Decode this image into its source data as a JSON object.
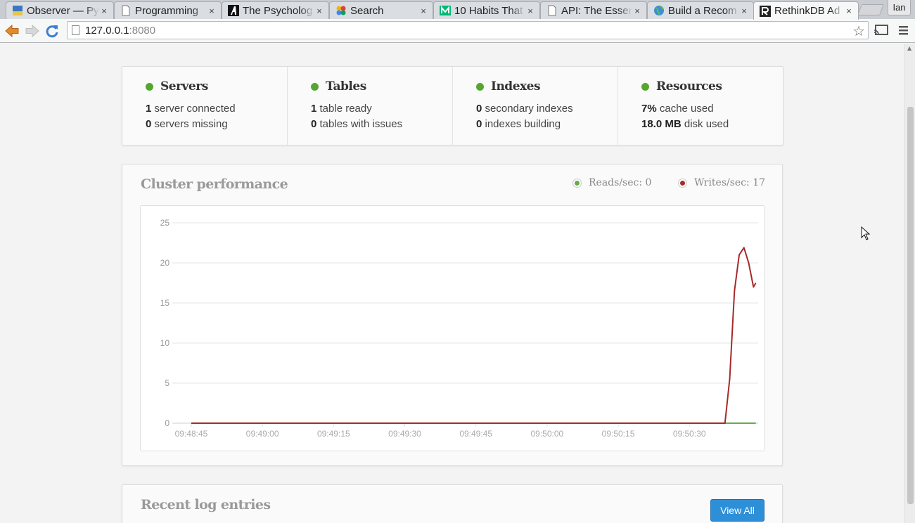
{
  "browser": {
    "tabs": [
      {
        "title": "Observer — Py",
        "icon": "observer-favicon"
      },
      {
        "title": "Programming",
        "icon": "document-favicon"
      },
      {
        "title": "The Psycholog",
        "icon": "atlantic-favicon"
      },
      {
        "title": "Search",
        "icon": "search-favicon"
      },
      {
        "title": "10 Habits That",
        "icon": "medium-favicon"
      },
      {
        "title": "API: The Essen",
        "icon": "document-favicon"
      },
      {
        "title": "Build a Recom",
        "icon": "globe-favicon"
      },
      {
        "title": "RethinkDB Ad",
        "icon": "rethinkdb-favicon",
        "active": true
      }
    ],
    "close_glyph": "×",
    "profile_name": "Ian",
    "url_host": "127.0.0.1",
    "url_port": ":8080"
  },
  "stats": [
    {
      "title": "Servers",
      "lines": [
        {
          "num": "1",
          "text": " server connected"
        },
        {
          "num": "0",
          "text": " servers missing"
        }
      ]
    },
    {
      "title": "Tables",
      "lines": [
        {
          "num": "1",
          "text": " table ready"
        },
        {
          "num": "0",
          "text": " tables with issues"
        }
      ]
    },
    {
      "title": "Indexes",
      "lines": [
        {
          "num": "0",
          "text": " secondary indexes"
        },
        {
          "num": "0",
          "text": " indexes building"
        }
      ]
    },
    {
      "title": "Resources",
      "lines": [
        {
          "num": "7%",
          "text": " cache used"
        },
        {
          "num": "18.0 MB",
          "text": " disk used"
        }
      ]
    }
  ],
  "status_color": "#55a630",
  "performance": {
    "title": "Cluster performance",
    "reads_label": "Reads/sec: 0",
    "writes_label": "Writes/sec: 17",
    "reads_color": "#6aa84f",
    "writes_color": "#a52a2a"
  },
  "chart_data": {
    "type": "line",
    "x": [
      "09:48:45",
      "09:49:00",
      "09:49:15",
      "09:49:30",
      "09:49:45",
      "09:50:00",
      "09:50:15",
      "09:50:30"
    ],
    "ylim": [
      0,
      25
    ],
    "yticks": [
      0,
      5,
      10,
      15,
      20,
      25
    ],
    "series": [
      {
        "name": "Reads/sec",
        "points": [
          [
            0,
            0
          ],
          [
            119,
            0
          ]
        ]
      },
      {
        "name": "Writes/sec",
        "points": [
          [
            0,
            0
          ],
          [
            112.5,
            0
          ],
          [
            113.5,
            5.5
          ],
          [
            114.5,
            16.5
          ],
          [
            115.5,
            21
          ],
          [
            116.5,
            21.9
          ],
          [
            117.5,
            20
          ],
          [
            118.5,
            17
          ],
          [
            119,
            17.5
          ]
        ]
      }
    ],
    "x_domain": [
      -4,
      119.5
    ]
  },
  "logs": {
    "title": "Recent log entries",
    "view_all": "View All"
  }
}
